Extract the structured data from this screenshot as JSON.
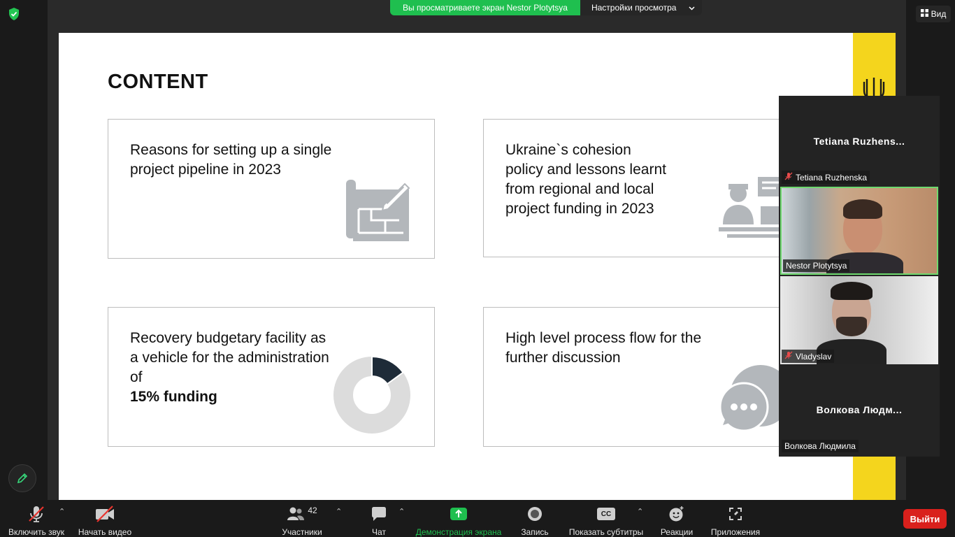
{
  "banner": {
    "viewing_text": "Вы просматриваете экран Nestor Plotytsya",
    "view_settings_label": "Настройки просмотра"
  },
  "view_button": {
    "label": "Вид"
  },
  "slide": {
    "title": "CONTENT",
    "cards": [
      {
        "text": "Reasons for setting up a single project pipeline in 2023",
        "icon": "blueprint-icon"
      },
      {
        "text": "Ukraine`s cohesion policy and lessons learnt from regional and local project funding in 2023",
        "icon": "presenter-icon"
      },
      {
        "text": "Recovery budgetary facility as a vehicle for the administration of",
        "bold": "15% funding",
        "icon": "donut-chart-icon"
      },
      {
        "text": "High level process flow for the further discussion",
        "icon": "chat-bubbles-icon"
      }
    ],
    "donut": {
      "highlight_fraction": 0.15,
      "highlight_color": "#1e2b38",
      "rest_color": "#dcdcdc"
    },
    "colors": {
      "stripe": "#f4d51d",
      "icon_gray": "#b3b7bb"
    }
  },
  "participants": [
    {
      "display_name": "Tetiana  Ruzhens...",
      "label": "Tetiana Ruzhenska",
      "muted": true,
      "video": false
    },
    {
      "display_name": "",
      "label": "Nestor Plotytsya",
      "muted": false,
      "video": true,
      "active": true
    },
    {
      "display_name": "",
      "label": "Vladyslav",
      "muted": true,
      "video": true
    },
    {
      "display_name": "Волкова  Людм...",
      "label": "Волкова Людмила",
      "muted": false,
      "video": false
    }
  ],
  "toolbar": {
    "unmute": "Включить звук",
    "start_video": "Начать видео",
    "participants": "Участники",
    "participants_count": "42",
    "chat": "Чат",
    "share_screen": "Демонстрация экрана",
    "record": "Запись",
    "captions": "Показать субтитры",
    "captions_icon_text": "CC",
    "reactions": "Реакции",
    "apps": "Приложения",
    "leave": "Выйти"
  },
  "colors": {
    "share_green": "#1fbf4f",
    "leave_red": "#d9201c",
    "active_border": "#6ed96e"
  }
}
